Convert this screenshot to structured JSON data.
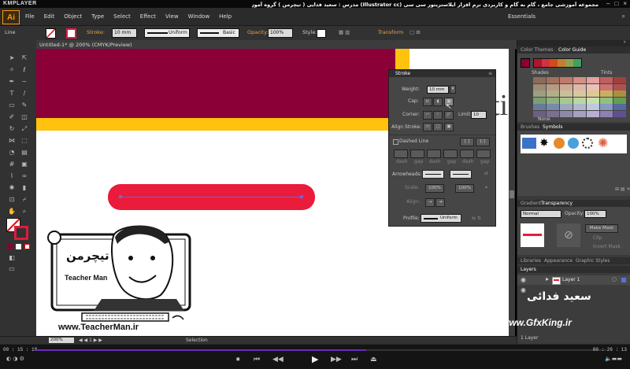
{
  "player": {
    "brand": "KMPLAYER",
    "elapsed": "00 : 15 : 18",
    "total": "00 : 26 : 13",
    "controls": [
      "⏹",
      "⏮",
      "◀◀",
      "▶",
      "▶▶",
      "⏭",
      "⏏"
    ]
  },
  "window_title": "مجموعه آموزشی جامع ، گام به گام و کاربردی نرم افزار ایلاستریتور سی سی (Illustrator cc) مدرس : سعید فدایی ( تیچرمن ) گروه آموزشی پادشاه گرافیست ها",
  "menu": {
    "app": "Ai",
    "items": [
      "File",
      "Edit",
      "Object",
      "Type",
      "Select",
      "Effect",
      "View",
      "Window",
      "Help"
    ],
    "workspace": "Essentials"
  },
  "control_bar": {
    "object": "Line",
    "stroke_label": "Stroke:",
    "stroke_value": "10 mm",
    "profile": "Uniform",
    "brush": "Basic",
    "opacity_label": "Opacity:",
    "opacity_value": "100%",
    "style_label": "Style:",
    "transform": "Transform"
  },
  "document": {
    "tab": "Untitled-1* @ 200% (CMYK/Preview)",
    "zoom": "200%",
    "status": "Selection",
    "partial_text": "ti"
  },
  "stroke_panel": {
    "title": "Stroke",
    "weight_label": "Weight:",
    "weight": "10 mm",
    "cap_label": "Cap:",
    "corner_label": "Corner:",
    "limit_label": "Limit:",
    "limit": "10",
    "align_label": "Align Stroke:",
    "dashed": "Dashed Line",
    "dash_labels": [
      "dash",
      "gap",
      "dash",
      "gap",
      "dash",
      "gap"
    ],
    "arrowheads": "Arrowheads:",
    "scale": "Scale:",
    "scale_a": "100%",
    "scale_b": "100%",
    "align": "Align:",
    "profile_label": "Profile:",
    "profile": "Uniform"
  },
  "color_panel": {
    "tabs": [
      "Color Themes",
      "Color Guide"
    ],
    "shades": "Shades",
    "tints": "Tints",
    "none": "None",
    "guide_colors": [
      "#b0152b",
      "#cc3344",
      "#d44b1a",
      "#c08030",
      "#90a050",
      "#40a060"
    ],
    "grid": [
      [
        "#8c6b5a",
        "#a0725f",
        "#c07a6a",
        "#d88f85",
        "#e8a0a0",
        "#c05f60",
        "#a0403d"
      ],
      [
        "#a08a78",
        "#b89a82",
        "#d2aa98",
        "#e0b6a8",
        "#eac0b8",
        "#d07070",
        "#b05050"
      ],
      [
        "#9aa080",
        "#b0b088",
        "#c8c098",
        "#d8c8a0",
        "#e0c890",
        "#c8b060",
        "#a89040"
      ],
      [
        "#7aa070",
        "#90b080",
        "#a8c890",
        "#b8d8a0",
        "#c8e0b0",
        "#90c080",
        "#60a050"
      ],
      [
        "#6a7a9a",
        "#7a8aaa",
        "#9aa8c0",
        "#b0b8d0",
        "#c0c8e0",
        "#8898c0",
        "#5868a0"
      ],
      [
        "#6a6080",
        "#7a7090",
        "#9088a8",
        "#a8a0c0",
        "#b8b0d0",
        "#9080b0",
        "#605090"
      ]
    ]
  },
  "brushes_panel": {
    "tabs": [
      "Brushes",
      "Symbols"
    ]
  },
  "gradient_panel": {
    "tabs": [
      "Gradient",
      "Transparency"
    ],
    "mode": "Normal",
    "opacity_label": "Opacity:",
    "opacity": "100%",
    "make_mask": "Make Mask",
    "clip": "Clip",
    "invert": "Invert Mask"
  },
  "libraries_panel": {
    "tabs": [
      "Libraries",
      "Appearance",
      "Graphic Styles"
    ]
  },
  "layers_panel": {
    "title": "Layers",
    "layer": "Layer 1",
    "count": "1 Layer"
  },
  "watermark": {
    "teacherman_site": "www.TeacherMan.ir",
    "logo_fa": "تیچرمن",
    "logo_en": "Teacher Man",
    "name_fa": "سعید فدائی",
    "site": "www.GfxKing.ir"
  },
  "colors": {
    "burgundy": "#8b0037",
    "yellow": "#ffc20e",
    "red_shape": "#ea1b3b",
    "selection": "#5a6ee0"
  }
}
